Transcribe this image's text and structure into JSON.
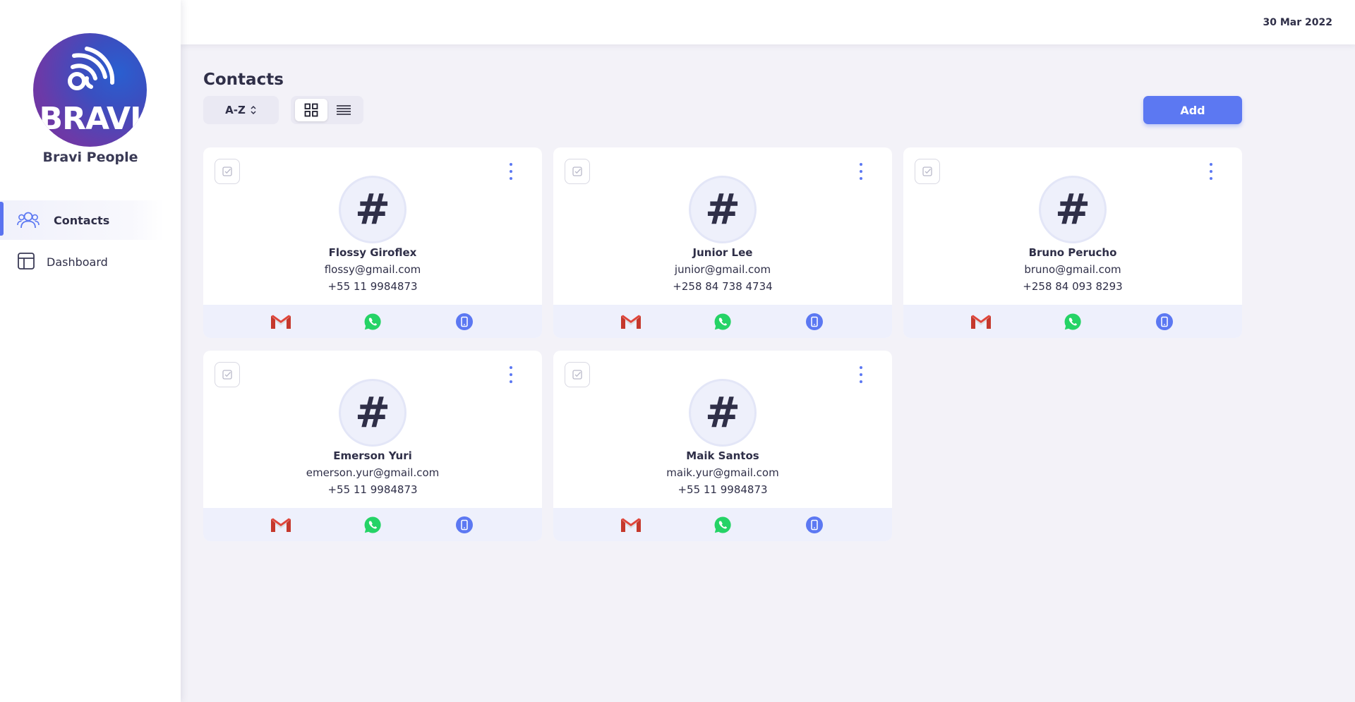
{
  "app": {
    "logo_text": "BRAVI",
    "brand_name": "Bravi People"
  },
  "sidebar": {
    "items": [
      {
        "label": "Contacts",
        "icon": "users-icon",
        "active": true
      },
      {
        "label": "Dashboard",
        "icon": "layout-icon",
        "active": false
      }
    ]
  },
  "topbar": {
    "date": "30 Mar 2022"
  },
  "main": {
    "title": "Contacts",
    "sort_label": "A-Z",
    "view_modes": [
      "grid",
      "list"
    ],
    "active_view": "grid",
    "add_label": "Add"
  },
  "contacts": [
    {
      "avatar": "#",
      "name": "Flossy Giroflex",
      "email": "flossy@gmail.com",
      "phone": "+55 11 9984873"
    },
    {
      "avatar": "#",
      "name": "Junior Lee",
      "email": "junior@gmail.com",
      "phone": "+258 84 738 4734"
    },
    {
      "avatar": "#",
      "name": "Bruno Perucho",
      "email": "bruno@gmail.com",
      "phone": "+258 84 093 8293"
    },
    {
      "avatar": "#",
      "name": "Emerson Yuri",
      "email": "emerson.yur@gmail.com",
      "phone": "+55 11 9984873"
    },
    {
      "avatar": "#",
      "name": "Maik Santos",
      "email": "maik.yur@gmail.com",
      "phone": "+55 11 9984873"
    }
  ],
  "colors": {
    "accent": "#5c78f2",
    "background": "#f3f2f8",
    "text": "#2f2f48",
    "whatsapp": "#25d366",
    "gmail_red": "#d44638"
  }
}
